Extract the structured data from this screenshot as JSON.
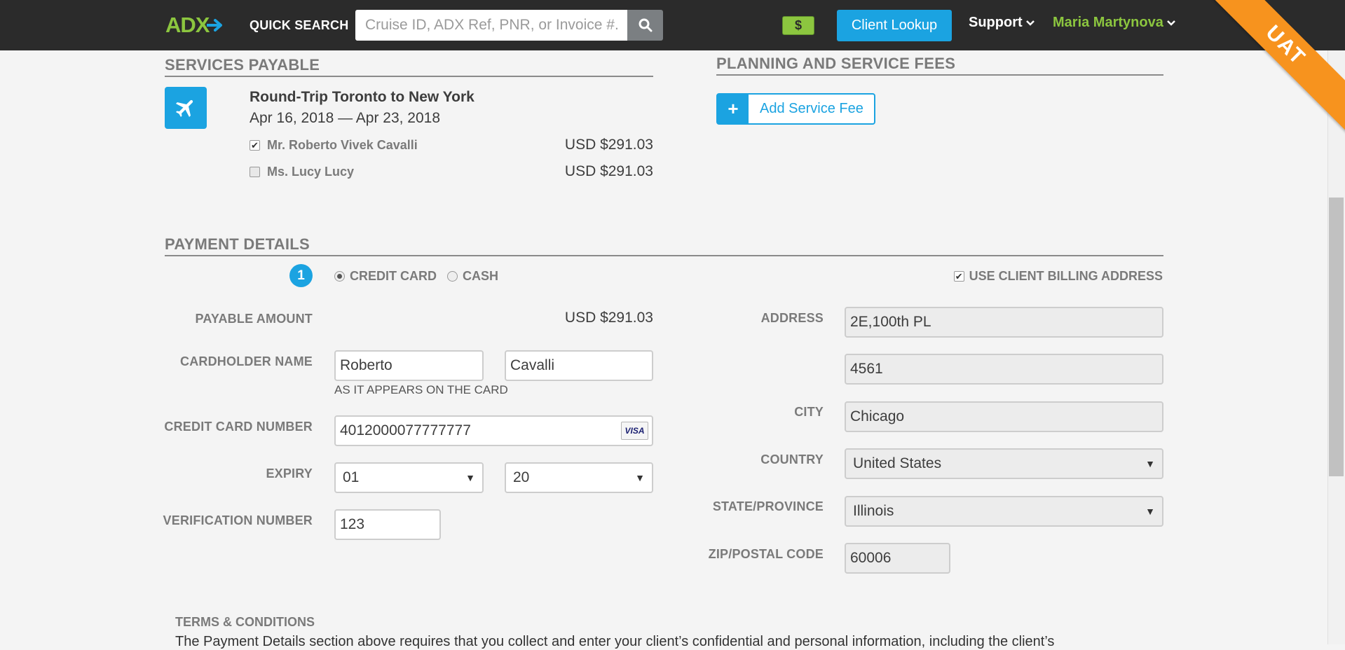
{
  "header": {
    "logo": "ADX",
    "quick_search_label": "QUICK SEARCH",
    "search_placeholder": "Cruise ID, ADX Ref, PNR, or Invoice #.",
    "wallet_label": "$",
    "client_lookup": "Client Lookup",
    "support": "Support",
    "user": "Maria Martynova",
    "env_ribbon": "UAT"
  },
  "services_payable": {
    "heading": "SERVICES PAYABLE",
    "trip_title": "Round-Trip Toronto to New York",
    "trip_dates": "Apr 16, 2018 — Apr 23, 2018",
    "passengers": [
      {
        "name": "Mr. Roberto Vivek Cavalli",
        "amount": "USD $291.03",
        "checked": true
      },
      {
        "name": "Ms. Lucy Lucy",
        "amount": "USD $291.03",
        "checked": false
      }
    ]
  },
  "service_fees": {
    "heading": "PLANNING AND SERVICE FEES",
    "add_button": "Add Service Fee"
  },
  "payment": {
    "heading": "PAYMENT DETAILS",
    "step": "1",
    "method_credit": "CREDIT CARD",
    "method_cash": "CASH",
    "selected_method": "credit",
    "use_billing": "USE CLIENT BILLING ADDRESS",
    "use_billing_checked": true,
    "payable_label": "PAYABLE AMOUNT",
    "payable_value": "USD $291.03",
    "cardholder_label": "CARDHOLDER NAME",
    "first_name": "Roberto",
    "last_name": "Cavalli",
    "cardholder_hint": "AS IT APPEARS ON THE CARD",
    "cc_label": "CREDIT CARD NUMBER",
    "cc_number": "4012000077777777",
    "cc_brand": "VISA",
    "expiry_label": "EXPIRY",
    "expiry_month": "01",
    "expiry_year": "20",
    "cvv_label": "VERIFICATION NUMBER",
    "cvv": "123",
    "address_label": "ADDRESS",
    "address1": "2E,100th PL",
    "address2": "4561",
    "city_label": "CITY",
    "city": "Chicago",
    "country_label": "COUNTRY",
    "country": "United States",
    "state_label": "STATE/PROVINCE",
    "state": "Illinois",
    "zip_label": "ZIP/POSTAL CODE",
    "zip": "60006"
  },
  "terms": {
    "heading": "TERMS & CONDITIONS",
    "text": "The Payment Details section above requires that you collect and enter your client’s confidential and personal information, including the client’s"
  },
  "colors": {
    "accent": "#1ba3e1",
    "brand_green": "#8cc63f",
    "nav_bg": "#2b2b2b",
    "ribbon": "#f7931e"
  }
}
